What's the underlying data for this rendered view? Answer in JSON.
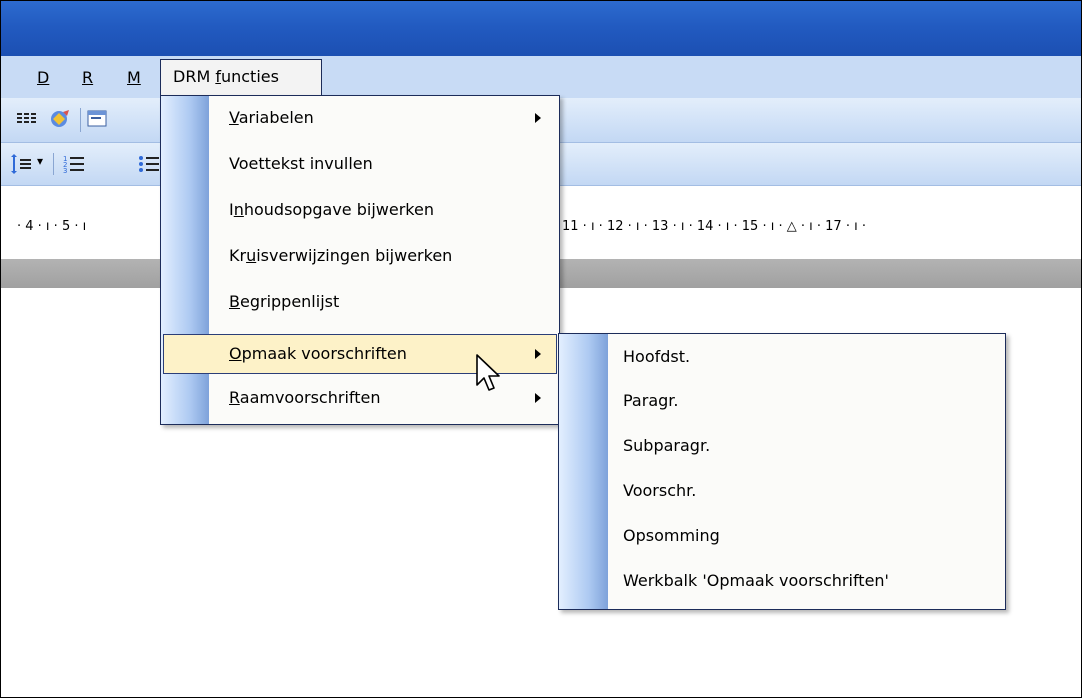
{
  "menubar": {
    "items": [
      {
        "label": "D"
      },
      {
        "label": "R"
      },
      {
        "label": "M"
      }
    ],
    "open_menu_prefix": "DRM ",
    "open_menu_underlined": "f",
    "open_menu_suffix": "uncties"
  },
  "toolbar": {
    "icons": [
      "columns-icon",
      "research-icon",
      "document-map-icon",
      "line-spacing-icon",
      "numbered-list-icon",
      "bulleted-list-icon"
    ],
    "dropdown_glyph": "▾"
  },
  "ruler": {
    "left_text": "· 4 · ı · 5 · ı",
    "right_text": "11 · ı · 12 · ı · 13 · ı · 14 · ı · 15 · ı · △ · ı · 17 · ı ·"
  },
  "dropdown": {
    "items": [
      {
        "pre": "",
        "ul": "V",
        "post": "ariabelen",
        "submenu": true
      },
      {
        "pre": "Voettekst invullen",
        "ul": "",
        "post": "",
        "submenu": false
      },
      {
        "pre": "I",
        "ul": "n",
        "post": "houdsopgave bijwerken",
        "submenu": false
      },
      {
        "pre": "Kr",
        "ul": "u",
        "post": "isverwijzingen bijwerken",
        "submenu": false
      },
      {
        "pre": "",
        "ul": "B",
        "post": "egrippenlijst",
        "submenu": false
      },
      {
        "pre": "",
        "ul": "O",
        "post": "pmaak voorschriften",
        "submenu": true,
        "highlighted": true
      },
      {
        "pre": "",
        "ul": "R",
        "post": "aamvoorschriften",
        "submenu": true
      }
    ]
  },
  "submenu": {
    "items": [
      "Hoofdst.",
      "Paragr.",
      "Subparagr.",
      "Voorschr.",
      "Opsomming",
      "Werkbalk 'Opmaak voorschriften'"
    ]
  },
  "colors": {
    "titlebar": "#2d6bcf",
    "menubar": "#c8dbf5",
    "highlight": "#fdf2c8",
    "menu_border": "#1c2c5a"
  }
}
